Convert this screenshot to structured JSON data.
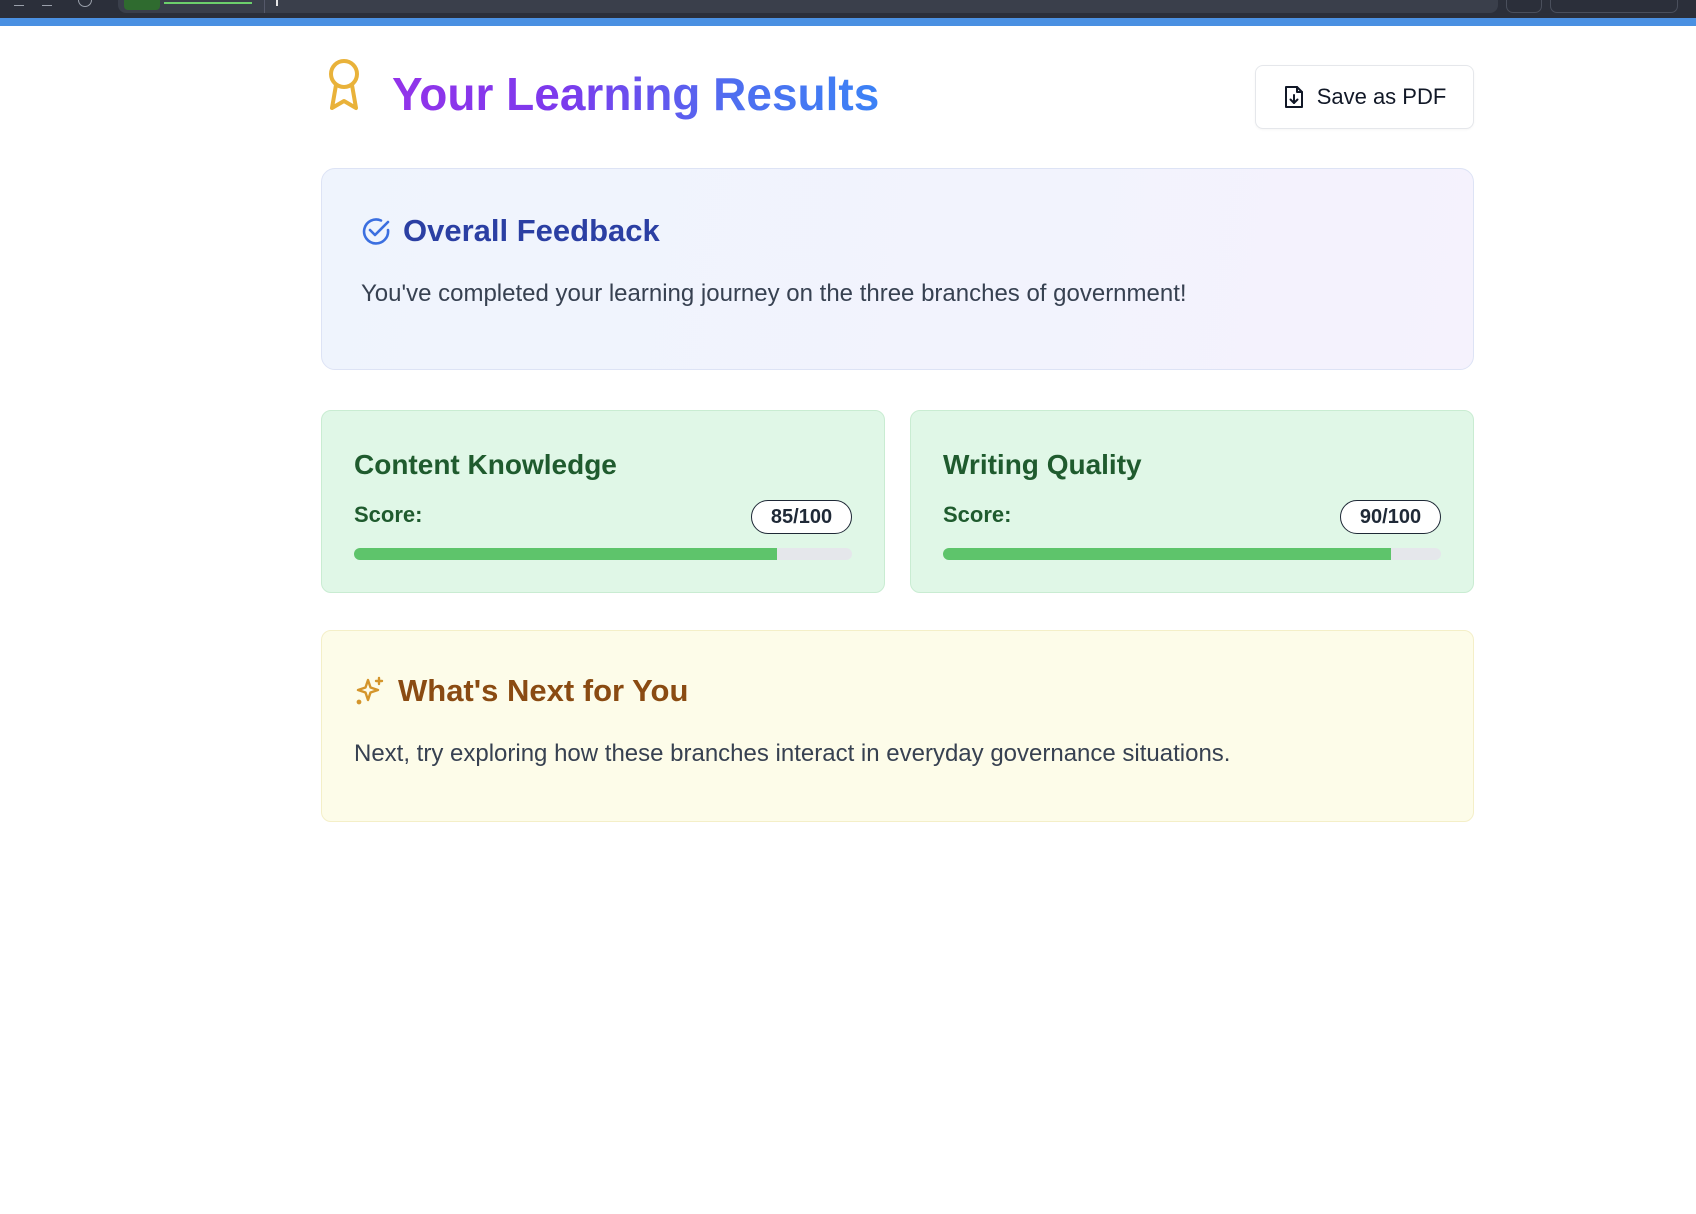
{
  "header": {
    "title": "Your Learning Results",
    "save_pdf_label": "Save as PDF",
    "icons": {
      "award": "award-icon",
      "pdf": "file-download-icon"
    }
  },
  "feedback": {
    "title": "Overall Feedback",
    "text": "You've completed your learning journey on the three branches of government!",
    "icon": "check-circle-icon"
  },
  "scores": [
    {
      "title": "Content Knowledge",
      "label": "Score:",
      "value_text": "85/100",
      "value": 85,
      "max": 100
    },
    {
      "title": "Writing Quality",
      "label": "Score:",
      "value_text": "90/100",
      "value": 90,
      "max": 100
    }
  ],
  "next": {
    "title": "What's Next for You",
    "text": "Next, try exploring how these branches interact in everyday governance situations.",
    "icon": "sparkles-icon"
  },
  "colors": {
    "accent_strip": "#4a90e2",
    "title_gradient_start": "#9333ea",
    "title_gradient_end": "#3b82f6",
    "feedback_title": "#2b3fa3",
    "score_card_bg": "#e0f7e7",
    "progress_fill": "#5ec46b",
    "next_card_bg": "#fdfce9",
    "next_title": "#8a4b12"
  }
}
